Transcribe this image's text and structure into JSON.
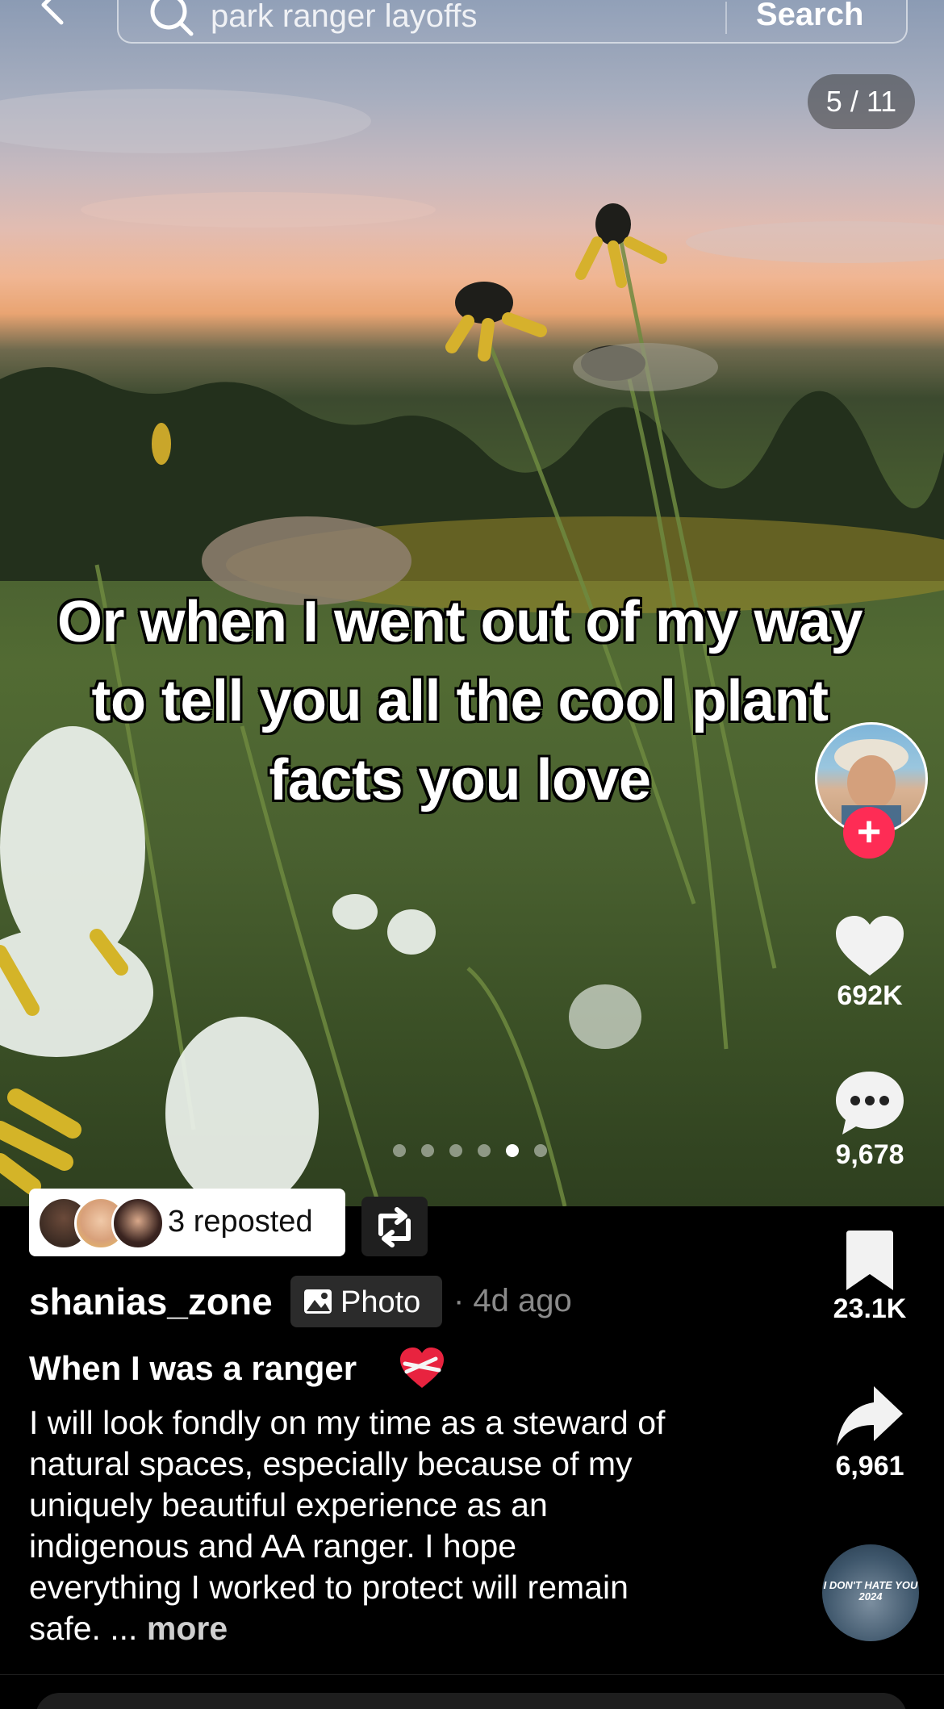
{
  "search": {
    "query": "park ranger layoffs",
    "button_label": "Search"
  },
  "photo": {
    "page_counter": "5 / 11",
    "caption": "Or when I went out of my way to tell you all the cool plant facts you love",
    "dots_total": 6,
    "dots_active_index": 4
  },
  "actions": {
    "likes": "692K",
    "comments": "9,678",
    "saves": "23.1K",
    "shares": "6,961"
  },
  "repost": {
    "label": "3 reposted"
  },
  "post": {
    "username": "shanias_zone",
    "badge_label": "Photo",
    "time_ago": "· 4d ago",
    "title": "When I was a ranger",
    "description": "I will look fondly on my time as a steward of natural spaces, especially because of my uniquely beautiful experience as an indigenous and AA ranger. I hope everything I worked to protect will remain safe. ...",
    "more_label": "more"
  },
  "music": {
    "disc_text": "I DON'T HATE YOU 2024"
  },
  "colors": {
    "follow_accent": "#fe2c55",
    "background": "#000000"
  }
}
